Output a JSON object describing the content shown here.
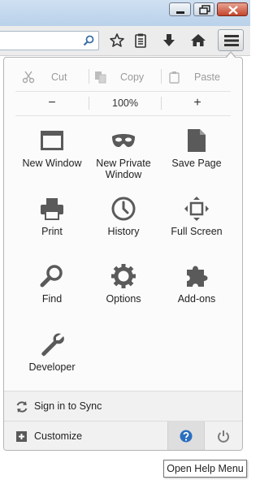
{
  "window_controls": {
    "minimize_icon": "minimize-icon",
    "restore_icon": "restore-icon",
    "close_icon": "close-icon"
  },
  "toolbar": {
    "search_icon": "search-icon",
    "bookmark_icon": "star-icon",
    "reading_icon": "clipboard-list-icon",
    "download_icon": "download-arrow-icon",
    "home_icon": "home-icon",
    "menu_icon": "hamburger-menu-icon"
  },
  "edit": {
    "cut": "Cut",
    "copy": "Copy",
    "paste": "Paste"
  },
  "zoom": {
    "minus": "−",
    "level": "100%",
    "plus": "+"
  },
  "items": {
    "new_window": "New Window",
    "new_private_window_line1": "New Private",
    "new_private_window_line2": "Window",
    "save_page": "Save Page",
    "print": "Print",
    "history": "History",
    "full_screen": "Full Screen",
    "find": "Find",
    "options": "Options",
    "add_ons": "Add-ons",
    "developer": "Developer"
  },
  "footer": {
    "sync": "Sign in to Sync",
    "customize": "Customize"
  },
  "tooltip": "Open Help Menu",
  "colors": {
    "icon_gray": "#5a5a5a",
    "help_blue": "#2a6fbf",
    "panel_bg": "#fbfbfb",
    "footer_bg": "#f1f1f1"
  }
}
